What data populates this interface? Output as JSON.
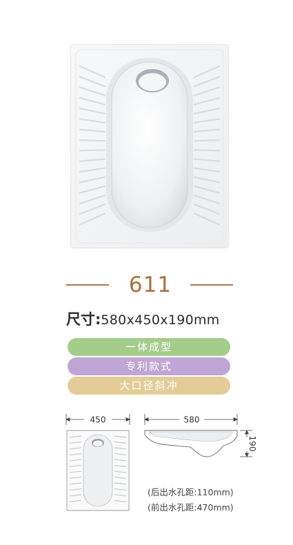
{
  "model": "611",
  "size": {
    "label": "尺寸:",
    "value": "580x450x190mm"
  },
  "features": [
    "一体成型",
    "专利款式",
    "大口径斜冲"
  ],
  "feature_colors": [
    "#a4cd8b",
    "#bfa6d4",
    "#e4cc98"
  ],
  "accent_color": "#a8703e",
  "drawings": {
    "top_view_width": "450",
    "side_view_length": "580",
    "side_view_height": "190",
    "notes": [
      "(后出水孔距:110mm)",
      "(前出水孔距:470mm)"
    ]
  }
}
